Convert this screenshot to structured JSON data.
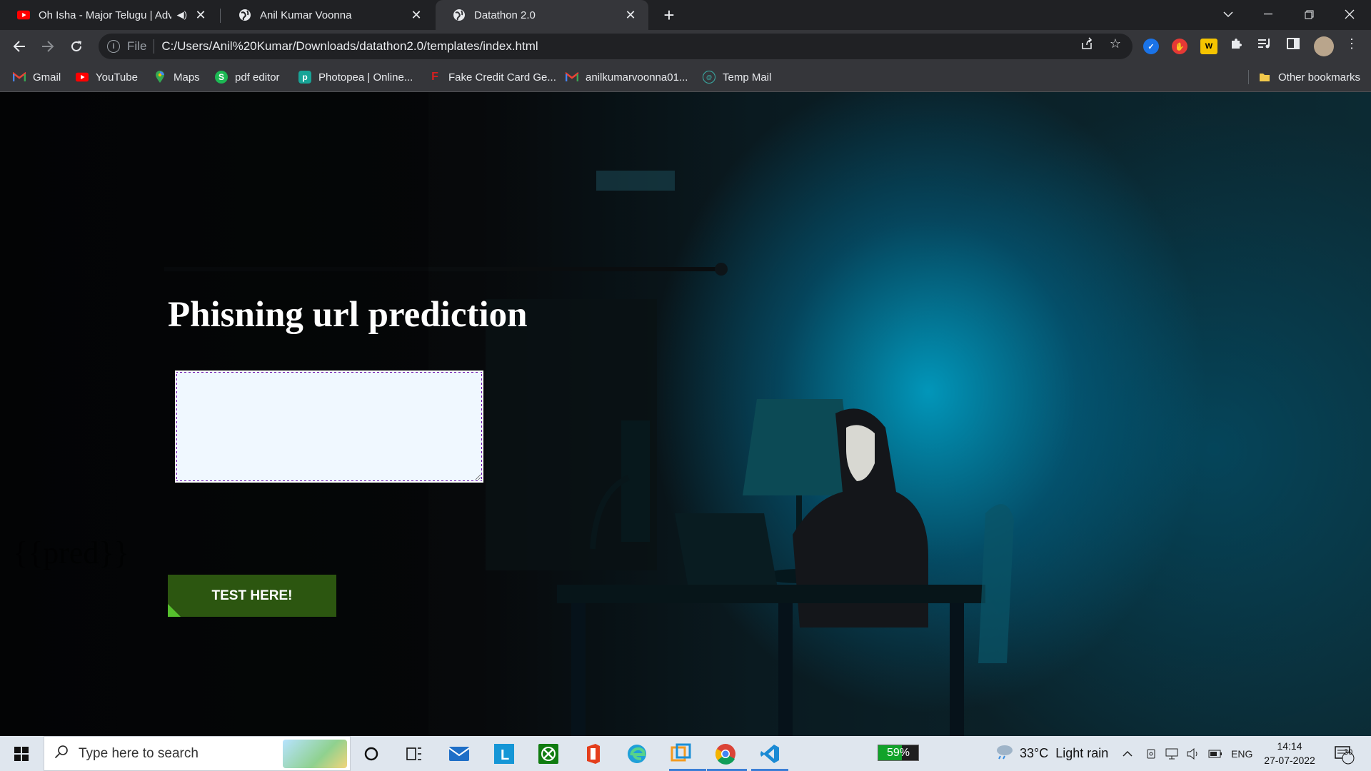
{
  "browser": {
    "tabs": [
      {
        "title": "Oh Isha - Major Telugu | Adv",
        "icon": "youtube-icon",
        "audio": true
      },
      {
        "title": "Anil Kumar Voonna",
        "icon": "globe-icon"
      },
      {
        "title": "Datathon 2.0",
        "icon": "globe-icon",
        "active": true
      }
    ],
    "address": {
      "scheme": "File",
      "url": "C:/Users/Anil%20Kumar/Downloads/datathon2.0/templates/index.html"
    },
    "bookmarks": [
      {
        "label": "Gmail",
        "icon": "gmail-icon"
      },
      {
        "label": "YouTube",
        "icon": "youtube-icon"
      },
      {
        "label": "Maps",
        "icon": "maps-icon"
      },
      {
        "label": "pdf editor",
        "icon": "pdf-editor-icon"
      },
      {
        "label": "Photopea | Online...",
        "icon": "photopea-icon"
      },
      {
        "label": "Fake Credit Card Ge...",
        "icon": "fake-credit-card-icon"
      },
      {
        "label": "anilkumarvoonna01...",
        "icon": "gmail-icon"
      },
      {
        "label": "Temp Mail",
        "icon": "temp-mail-icon"
      }
    ],
    "other_bookmarks": "Other bookmarks"
  },
  "page": {
    "heading": "Phisning url prediction",
    "input": {
      "value": "",
      "placeholder": ""
    },
    "faint_text": "{{pred}}",
    "button_label": "TEST HERE!"
  },
  "taskbar": {
    "search_placeholder": "Type here to search",
    "battery": {
      "percent": 59,
      "label": "59%"
    },
    "weather": {
      "temp": "33°C",
      "condition": "Light rain"
    },
    "language": "ENG",
    "time": "14:14",
    "date": "27-07-2022",
    "notifications": "30"
  }
}
